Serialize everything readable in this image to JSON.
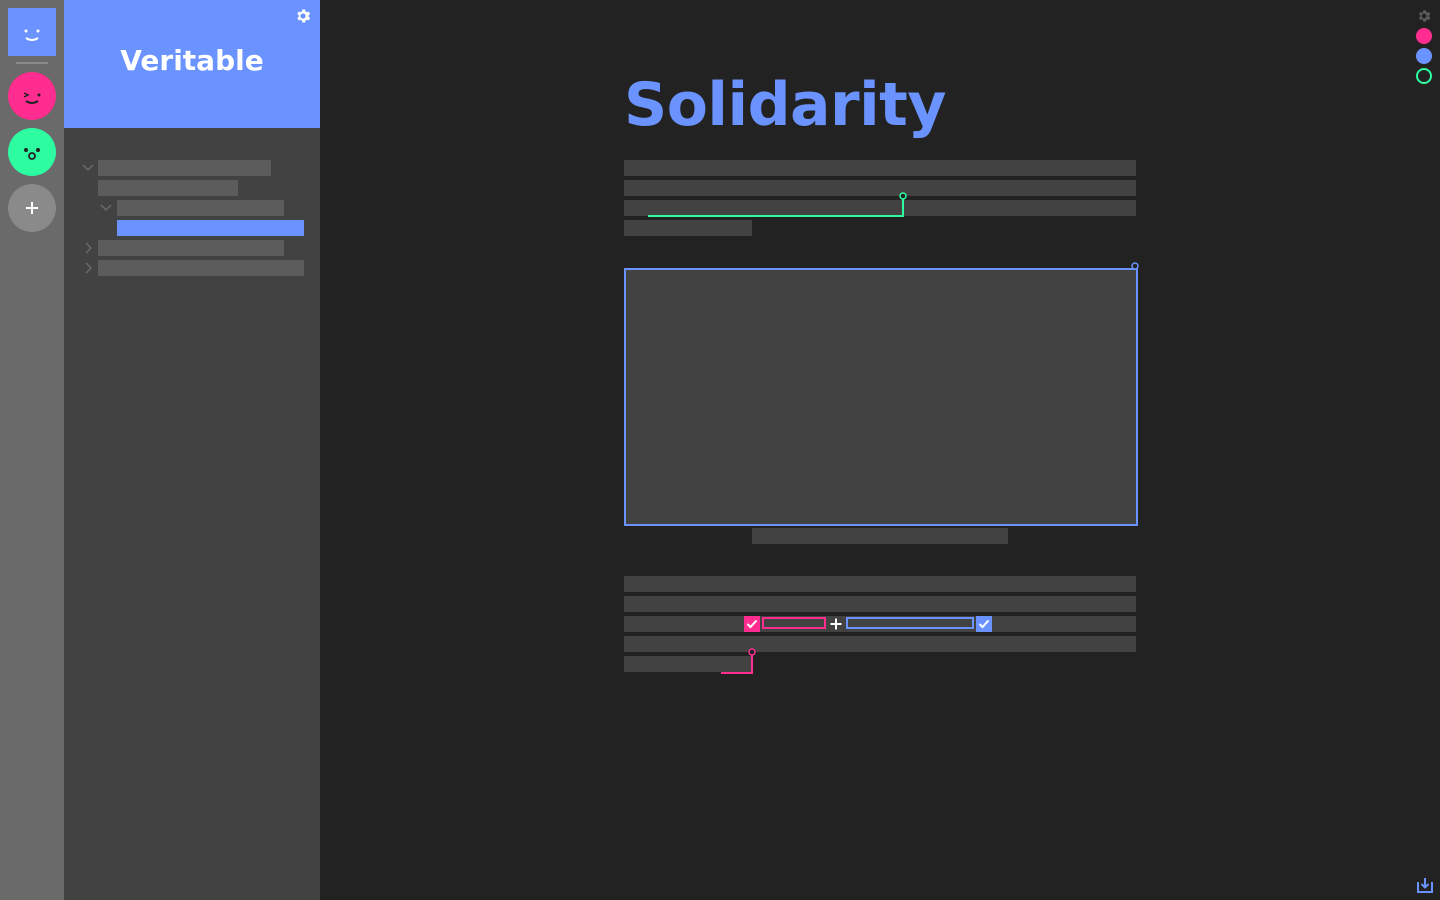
{
  "app": {
    "sidebar_title": "Veritable"
  },
  "document": {
    "title": "Solidarity"
  },
  "colors": {
    "accent_blue": "#6a93ff",
    "accent_pink": "#ff2d8f",
    "accent_green": "#2dfca0",
    "background": "#222222",
    "sidebar": "#424242",
    "rail": "#6a6a6a"
  },
  "rail": {
    "avatars": [
      {
        "name": "blue-smiley-avatar",
        "color": "#6a93ff"
      },
      {
        "name": "pink-smiley-avatar",
        "color": "#ff2d8f"
      },
      {
        "name": "green-surprised-avatar",
        "color": "#2dfca0"
      }
    ],
    "add_icon": "plus-icon"
  },
  "icons": {
    "settings": "gear-icon",
    "expand": "chevron-down-icon",
    "collapse": "chevron-right-icon",
    "accept": "check-icon",
    "insert": "plus-icon",
    "download": "download-icon"
  }
}
